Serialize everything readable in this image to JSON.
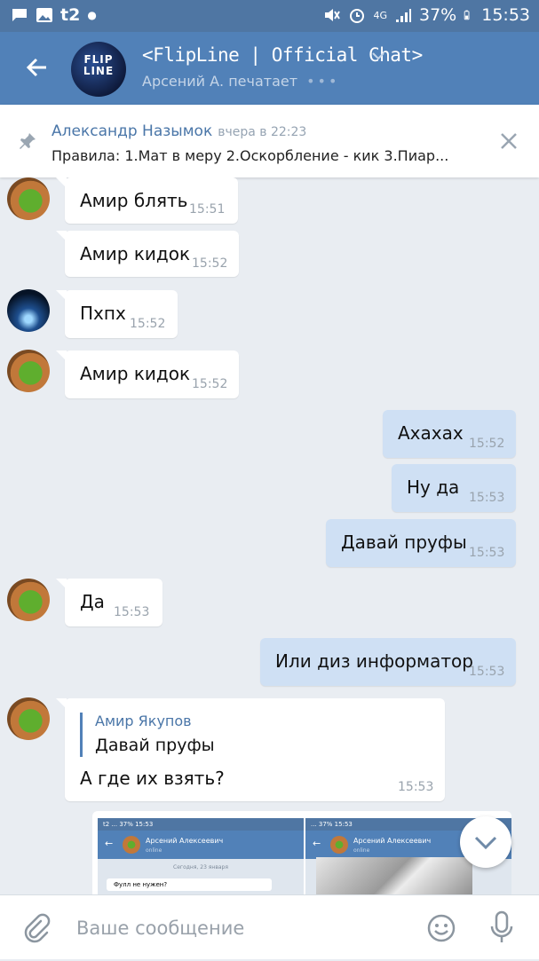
{
  "status_bar": {
    "carrier": "t2",
    "network": "4G",
    "battery": "37%",
    "time": "15:53"
  },
  "header": {
    "avatar_text": "FLIP LINE",
    "title": "<FlipLine | Official Chat>",
    "subtitle": "Арсений А. печатает",
    "typing_dots": "•••"
  },
  "pinned": {
    "author": "Александр Назымок",
    "time": "вчера в 22:23",
    "text": "Правила: 1.Мат в меру 2.Оскорбление - кик 3.Пиар..."
  },
  "messages": [
    {
      "dir": "in",
      "avatar": "frog-avatar",
      "text": "Амир блять",
      "time": "15:51"
    },
    {
      "dir": "in",
      "avatar": "",
      "text": "Амир кидок",
      "time": "15:52"
    },
    {
      "dir": "in",
      "avatar": "earth-avatar",
      "text": "Пхпх",
      "time": "15:52"
    },
    {
      "dir": "in",
      "avatar": "frog-avatar",
      "text": "Амир кидок",
      "time": "15:52"
    },
    {
      "dir": "out",
      "text": "Ахахах",
      "time": "15:52"
    },
    {
      "dir": "out",
      "text": "Ну да",
      "time": "15:53"
    },
    {
      "dir": "out",
      "text": "Давай пруфы",
      "time": "15:53"
    },
    {
      "dir": "in",
      "avatar": "frog-avatar",
      "text": "Да",
      "time": "15:53"
    },
    {
      "dir": "out",
      "text": "Или диз информатор",
      "time": "15:53"
    },
    {
      "dir": "in",
      "avatar": "frog-avatar",
      "reply_to_name": "Амир Якупов",
      "reply_to_text": "Давай пруфы",
      "text": "А где их взять?",
      "time": "15:53"
    }
  ],
  "attachment": {
    "shot1": {
      "status": "t2 ... 37% 15:53",
      "name": "Арсений Алексеевич",
      "status_text": "online",
      "date": "Сегодня, 23 января",
      "message": "Фулл не нужен?"
    },
    "shot2": {
      "status": "... 37% 15:53",
      "name": "Арсений Алексеевич",
      "status_text": "online"
    }
  },
  "composer": {
    "placeholder": "Ваше сообщение"
  },
  "colors": {
    "header": "#5181b8",
    "status_bar": "#4f76a3",
    "background": "#e9edf2",
    "outgoing_bubble": "#cfe0f4",
    "incoming_bubble": "#ffffff",
    "link": "#4a76a8"
  }
}
